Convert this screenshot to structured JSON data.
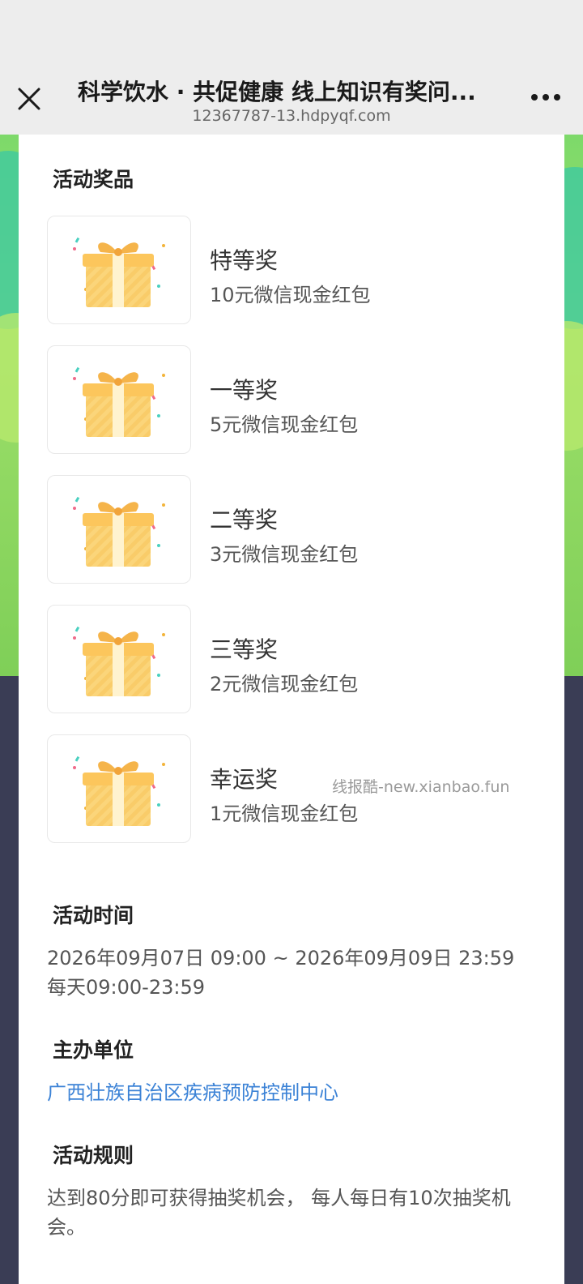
{
  "nav": {
    "title": "科学饮水 · 共促健康 线上知识有奖问...",
    "url": "12367787-13.hdpyqf.com",
    "close_icon": "close-icon",
    "more_icon": "more-dots-icon"
  },
  "prizes_section": {
    "title": "活动奖品",
    "items": [
      {
        "name": "特等奖",
        "desc": "10元微信现金红包",
        "icon": "gift-box-icon"
      },
      {
        "name": "一等奖",
        "desc": "5元微信现金红包",
        "icon": "gift-box-icon"
      },
      {
        "name": "二等奖",
        "desc": "3元微信现金红包",
        "icon": "gift-box-icon"
      },
      {
        "name": "三等奖",
        "desc": "2元微信现金红包",
        "icon": "gift-box-icon"
      },
      {
        "name": "幸运奖",
        "desc": "1元微信现金红包",
        "icon": "gift-box-icon"
      }
    ]
  },
  "watermark": "线报酷-new.xianbao.fun",
  "time_section": {
    "title": "活动时间",
    "range": "2026年09月07日 09:00 ~ 2026年09月09日 23:59",
    "daily": "每天09:00-23:59"
  },
  "organizer_section": {
    "title": "主办单位",
    "name": "广西壮族自治区疾病预防控制中心"
  },
  "rules_section": {
    "title": "活动规则",
    "text": "达到80分即可获得抽奖机会， 每人每日有10次抽奖机会。"
  },
  "colors": {
    "link": "#3b82d6",
    "nav_bg": "#ededed",
    "page_bg": "#3a3d55"
  }
}
